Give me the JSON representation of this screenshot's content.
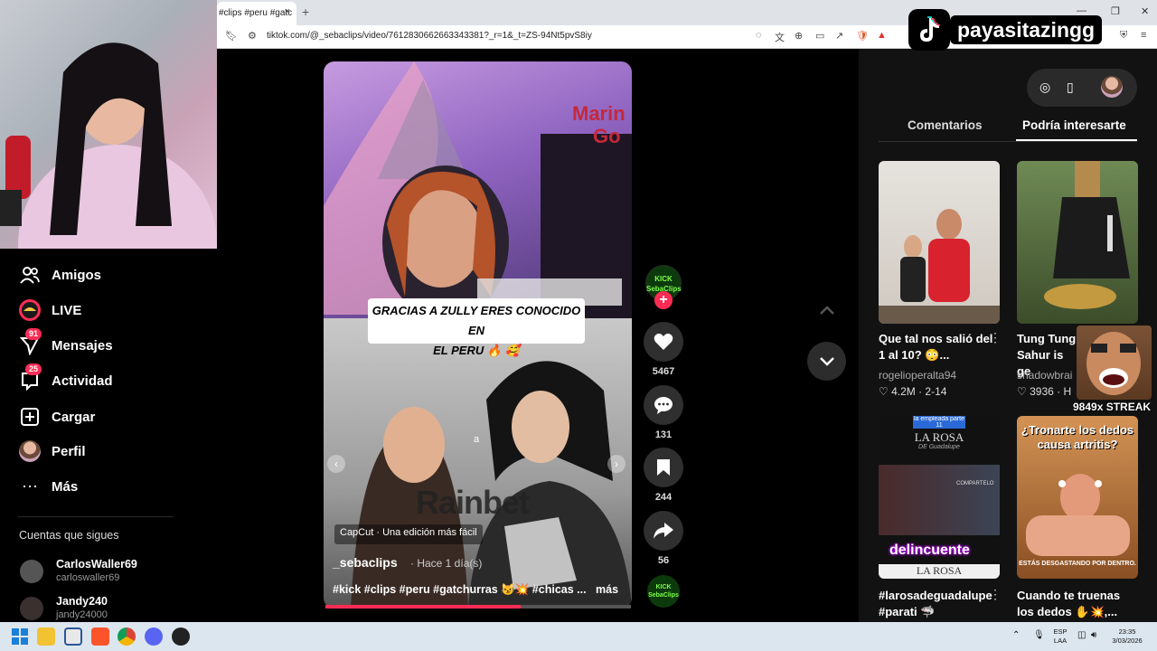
{
  "browser": {
    "tab_title": "#clips #peru #gatc",
    "close_glyph": "×",
    "newtab_glyph": "+",
    "url": "tiktok.com/@_sebaclips/video/7612830662663343381?_r=1&_t=ZS-94Nt5pvS8iy"
  },
  "overlay": {
    "channel_name": "payasitazingg",
    "streak": "9849x STREAK"
  },
  "sidebar": {
    "items": [
      {
        "label": "Amigos",
        "icon": "friends-icon"
      },
      {
        "label": "LIVE",
        "icon": "live-icon"
      },
      {
        "label": "Mensajes",
        "icon": "messages-icon",
        "badge": "91"
      },
      {
        "label": "Actividad",
        "icon": "activity-icon",
        "badge": "25"
      },
      {
        "label": "Cargar",
        "icon": "upload-icon"
      },
      {
        "label": "Perfil",
        "icon": "profile-avatar"
      },
      {
        "label": "Más",
        "icon": "more-icon"
      }
    ],
    "following_title": "Cuentas que sigues",
    "following": [
      {
        "name": "CarlosWaller69",
        "handle": "carloswaller69"
      },
      {
        "name": "Jandy240",
        "handle": "jandy24000"
      }
    ]
  },
  "video": {
    "caption_line1": "GRACIAS A ZULLY ERES CONOCIDO EN",
    "caption_line2": "EL PERU 🔥 🥰",
    "watermark": "Rainbet",
    "capcut_label": "CapCut · Una edición más fácil",
    "author": "_sebaclips",
    "time": "· Hace 1 día(s)",
    "hashtags": "#kick #clips #peru #gatchurras 😼💥 #chicas ...",
    "more": "más",
    "small_char": "a",
    "progress": 0.64,
    "creator_badge": "KICK SebaClips"
  },
  "actions": {
    "likes": "5467",
    "comments": "131",
    "saves": "244",
    "shares": "56"
  },
  "right_panel": {
    "tabs": [
      "Comentarios",
      "Podría interesarte"
    ],
    "recommendations": [
      {
        "title": "Que tal nos salió del 1 al 10? 😳...",
        "author": "rogelioperalta94",
        "stats": "♡ 4.2M · 2-14"
      },
      {
        "title": "Tung Tung Sahur is ge",
        "author": "shadowbrai",
        "stats": "♡ 3936 · H"
      },
      {
        "title": "#larosadeguadalupe #parati 🦈",
        "thumb_top": "la empleada parte 11",
        "thumb_brand": "LA ROSA",
        "thumb_subbrand": "DE Guadalupe",
        "thumb_overlay": "delincuente",
        "thumb_bottom_brand": "LA ROSA",
        "thumb_tag": "COMPARTELO"
      },
      {
        "title": "Cuando te truenas los dedos ✋💥,...",
        "thumb_headline": "¿Tronarte los dedos causa artritis?",
        "thumb_caption": "ESTÁS DESGASTANDO POR DENTRO."
      }
    ]
  },
  "taskbar": {
    "lang": "ESP",
    "lang2": "LAA",
    "time": "23:35",
    "date": "3/03/2026"
  },
  "colors": {
    "accent": "#fe2c55",
    "background": "#000000",
    "panel": "#121212"
  }
}
